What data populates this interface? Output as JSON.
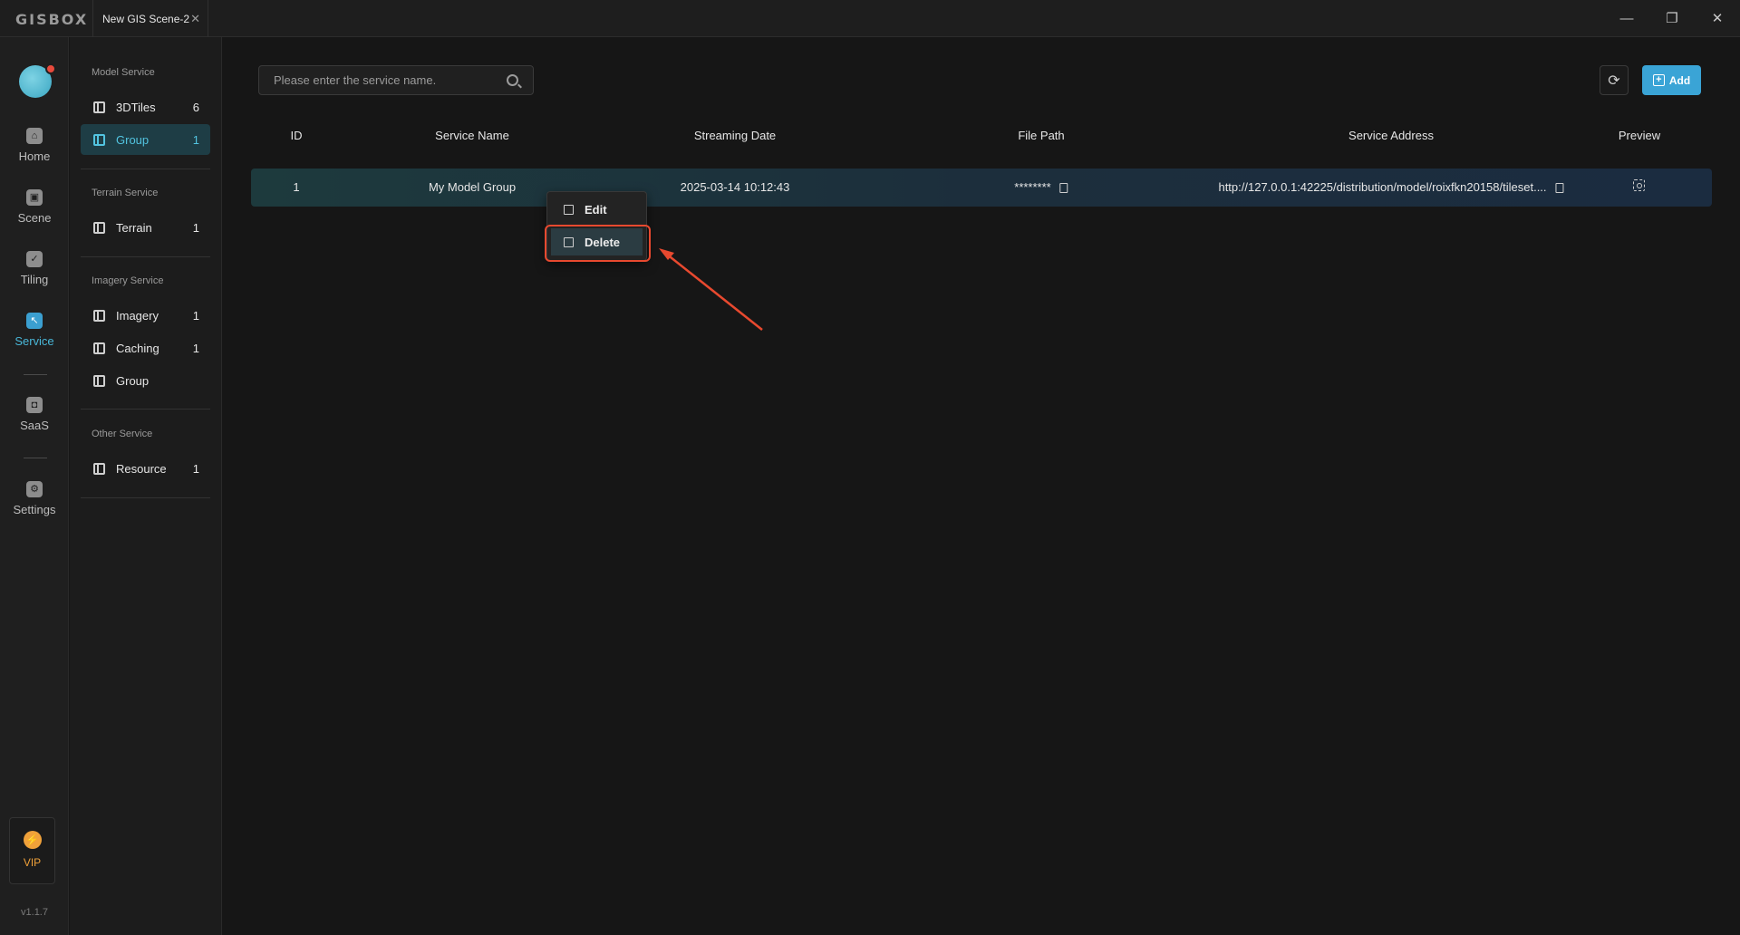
{
  "app": {
    "logo": "GISBOX",
    "tab_title": "New GIS Scene-2",
    "tab_close": "✕",
    "window_controls": {
      "minimize": "—",
      "restore": "❐",
      "close": "✕"
    }
  },
  "rail": {
    "items": [
      {
        "label": "Home",
        "icon": "home-icon"
      },
      {
        "label": "Scene",
        "icon": "scene-icon"
      },
      {
        "label": "Tiling",
        "icon": "tiling-icon"
      },
      {
        "label": "Service",
        "icon": "service-icon",
        "active": true
      },
      {
        "label": "SaaS",
        "icon": "lock-icon"
      },
      {
        "label": "Settings",
        "icon": "gear-icon"
      }
    ],
    "vip": "VIP",
    "version": "v1.1.7"
  },
  "sidebar": {
    "model_heading": "Model Service",
    "model_items": [
      {
        "label": "3DTiles",
        "count": "6"
      },
      {
        "label": "Group",
        "count": "1",
        "active": true
      }
    ],
    "terrain_heading": "Terrain Service",
    "terrain_items": [
      {
        "label": "Terrain",
        "count": "1"
      }
    ],
    "imagery_heading": "Imagery Service",
    "imagery_items": [
      {
        "label": "Imagery",
        "count": "1"
      },
      {
        "label": "Caching",
        "count": "1"
      },
      {
        "label": "Group",
        "count": ""
      }
    ],
    "other_heading": "Other Service",
    "other_items": [
      {
        "label": "Resource",
        "count": "1"
      }
    ]
  },
  "toolbar": {
    "search_placeholder": "Please enter the service name.",
    "refresh_icon": "⟳",
    "add_label": "Add"
  },
  "table": {
    "headers": [
      "ID",
      "Service Name",
      "Streaming Date",
      "File Path",
      "Service Address",
      "Preview"
    ],
    "rows": [
      {
        "id": "1",
        "name": "My Model Group",
        "date": "2025-03-14 10:12:43",
        "path": "********",
        "address": "http://127.0.0.1:42225/distribution/model/roixfkn20158/tileset...."
      }
    ]
  },
  "context_menu": {
    "edit": "Edit",
    "delete": "Delete"
  },
  "colors": {
    "accent": "#3aa4d6",
    "active_text": "#52c4e0",
    "highlight": "#e8492f",
    "vip": "#f0a13a"
  }
}
